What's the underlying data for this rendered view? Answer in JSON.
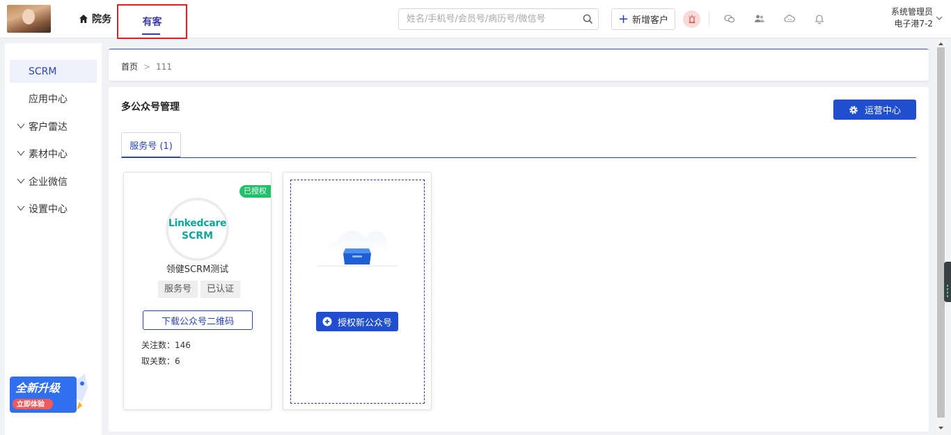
{
  "topbar": {
    "nav_home": "院务",
    "nav_youke": "有客",
    "search_placeholder": "姓名/手机号/会员号/病历号/微信号",
    "add_customer": "新增客户",
    "user_role": "系统管理员",
    "user_branch": "电子港7-2",
    "icons": [
      "home-icon",
      "search-icon",
      "plus-icon",
      "alarm-icon",
      "wechat-icon",
      "group-icon",
      "cloud-icon",
      "bell-icon",
      "chevron-down-icon"
    ]
  },
  "sidebar": {
    "items": [
      {
        "label": "SCRM",
        "active": true,
        "expandable": false
      },
      {
        "label": "应用中心",
        "active": false,
        "expandable": false
      },
      {
        "label": "客户雷达",
        "active": false,
        "expandable": true
      },
      {
        "label": "素材中心",
        "active": false,
        "expandable": true
      },
      {
        "label": "企业微信",
        "active": false,
        "expandable": true
      },
      {
        "label": "设置中心",
        "active": false,
        "expandable": true
      }
    ],
    "promo_title": "全新升级",
    "promo_sub": "立即体验"
  },
  "breadcrumb": {
    "home": "首页",
    "sep": ">",
    "current": "111"
  },
  "main": {
    "title": "多公众号管理",
    "ops_button": "运营中心",
    "tab_label": "服务号 (1)",
    "account": {
      "badge": "已授权",
      "logo_top": "Linkedcare",
      "logo_bottom": "SCRM",
      "name": "领健SCRM测试",
      "tags": [
        "服务号",
        "已认证"
      ],
      "download_button": "下载公众号二维码",
      "followers_label": "关注数：",
      "followers": "146",
      "unfollows_label": "取关数：",
      "unfollows": "6"
    },
    "authorize_button": "授权新公众号"
  },
  "colors": {
    "primary": "#1f4fcf",
    "accent_text": "#2a45b8",
    "success": "#21c06a",
    "brand_teal": "#10a59b",
    "highlight_border": "#e02020"
  }
}
